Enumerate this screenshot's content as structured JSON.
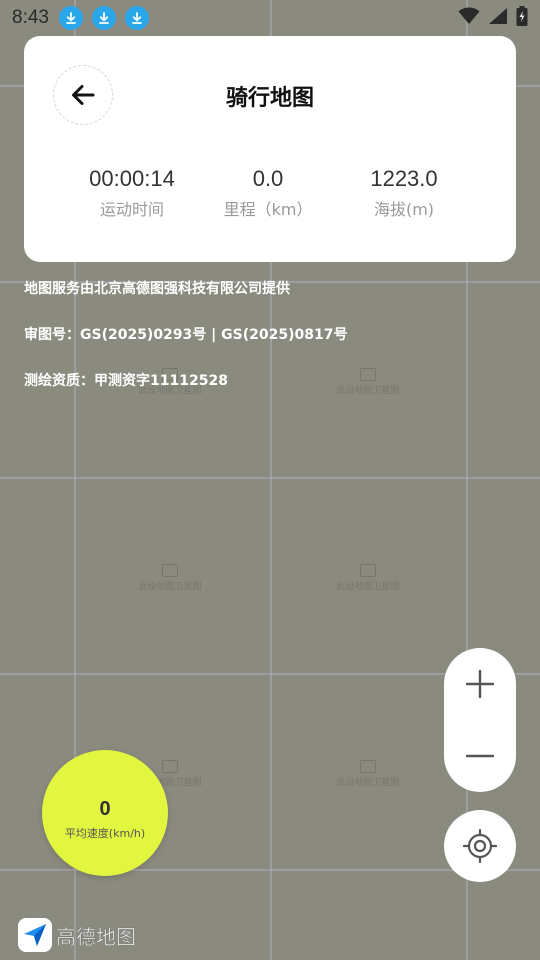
{
  "status_bar": {
    "time": "8:43",
    "notifications": [
      "download-icon",
      "download-icon",
      "download-icon"
    ],
    "right_icons": [
      "wifi-icon",
      "signal-icon",
      "battery-charging-icon"
    ]
  },
  "header": {
    "title": "骑行地图",
    "back_icon": "arrow-left-icon"
  },
  "stats": [
    {
      "value": "00:00:14",
      "label": "运动时间"
    },
    {
      "value": "0.0",
      "label": "里程（km）"
    },
    {
      "value": "1223.0",
      "label": "海拔(m)"
    }
  ],
  "map_credits": {
    "provider": "地图服务由北京高德图强科技有限公司提供",
    "approval": "审图号：GS(2025)0293号 | GS(2025)0817号",
    "qualification": "测绘资质：甲测资字11112528"
  },
  "map_watermark": "此设地图卫星图",
  "speed": {
    "value": "0",
    "label": "平均速度(km/h)"
  },
  "controls": {
    "zoom_in_icon": "plus-icon",
    "zoom_out_icon": "minus-icon",
    "locate_icon": "locate-icon"
  },
  "logo": {
    "text": "高德地图"
  },
  "colors": {
    "map_background": "#8a8a7e",
    "speed_bubble": "#e2f53f",
    "notification_icon": "#2aa6ea",
    "card": "#ffffff"
  }
}
